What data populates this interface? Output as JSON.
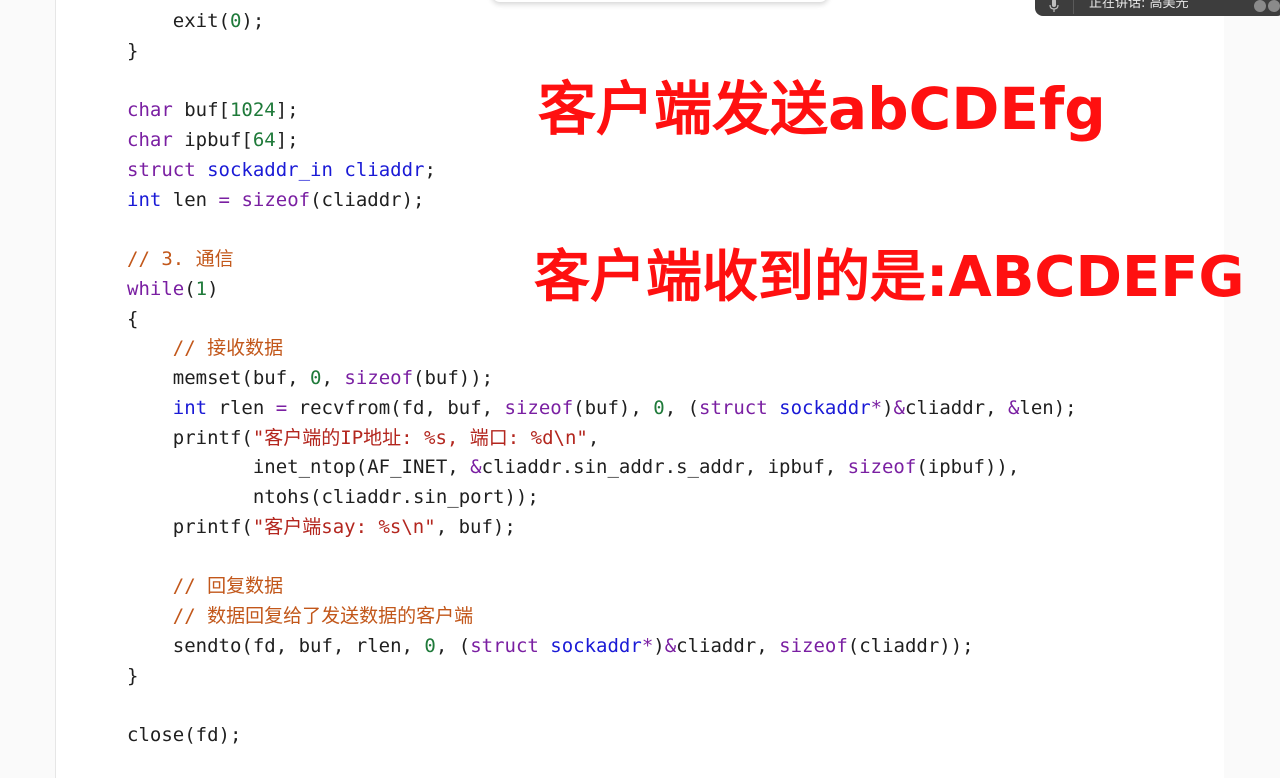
{
  "code": {
    "lines": [
      [
        {
          "t": "    exit(",
          "k": "plain"
        },
        {
          "t": "0",
          "k": "number"
        },
        {
          "t": ");",
          "k": "plain"
        }
      ],
      [
        {
          "t": "}",
          "k": "plain"
        }
      ],
      [],
      [
        {
          "t": "char",
          "k": "keyword"
        },
        {
          "t": " buf[",
          "k": "plain"
        },
        {
          "t": "1024",
          "k": "number"
        },
        {
          "t": "];",
          "k": "plain"
        }
      ],
      [
        {
          "t": "char",
          "k": "keyword"
        },
        {
          "t": " ipbuf[",
          "k": "plain"
        },
        {
          "t": "64",
          "k": "number"
        },
        {
          "t": "];",
          "k": "plain"
        }
      ],
      [
        {
          "t": "struct",
          "k": "keyword"
        },
        {
          "t": " ",
          "k": "plain"
        },
        {
          "t": "sockaddr_in",
          "k": "type"
        },
        {
          "t": " ",
          "k": "plain"
        },
        {
          "t": "cliaddr",
          "k": "type"
        },
        {
          "t": ";",
          "k": "plain"
        }
      ],
      [
        {
          "t": "int",
          "k": "type"
        },
        {
          "t": " len ",
          "k": "plain"
        },
        {
          "t": "=",
          "k": "keyword"
        },
        {
          "t": " ",
          "k": "plain"
        },
        {
          "t": "sizeof",
          "k": "keyword"
        },
        {
          "t": "(cliaddr);",
          "k": "plain"
        }
      ],
      [],
      [
        {
          "t": "// 3. 通信",
          "k": "comment"
        }
      ],
      [
        {
          "t": "while",
          "k": "keyword"
        },
        {
          "t": "(",
          "k": "plain"
        },
        {
          "t": "1",
          "k": "number"
        },
        {
          "t": ")",
          "k": "plain"
        }
      ],
      [
        {
          "t": "{",
          "k": "plain"
        }
      ],
      [
        {
          "t": "    ",
          "k": "plain"
        },
        {
          "t": "// 接收数据",
          "k": "comment"
        }
      ],
      [
        {
          "t": "    memset(buf, ",
          "k": "plain"
        },
        {
          "t": "0",
          "k": "number"
        },
        {
          "t": ", ",
          "k": "plain"
        },
        {
          "t": "sizeof",
          "k": "keyword"
        },
        {
          "t": "(buf));",
          "k": "plain"
        }
      ],
      [
        {
          "t": "    ",
          "k": "plain"
        },
        {
          "t": "int",
          "k": "type"
        },
        {
          "t": " rlen ",
          "k": "plain"
        },
        {
          "t": "=",
          "k": "keyword"
        },
        {
          "t": " recvfrom(fd, buf, ",
          "k": "plain"
        },
        {
          "t": "sizeof",
          "k": "keyword"
        },
        {
          "t": "(buf), ",
          "k": "plain"
        },
        {
          "t": "0",
          "k": "number"
        },
        {
          "t": ", (",
          "k": "plain"
        },
        {
          "t": "struct",
          "k": "keyword"
        },
        {
          "t": " ",
          "k": "plain"
        },
        {
          "t": "sockaddr",
          "k": "type"
        },
        {
          "t": "*",
          "k": "keyword"
        },
        {
          "t": ")",
          "k": "plain"
        },
        {
          "t": "&",
          "k": "keyword"
        },
        {
          "t": "cliaddr, ",
          "k": "plain"
        },
        {
          "t": "&",
          "k": "keyword"
        },
        {
          "t": "len);",
          "k": "plain"
        }
      ],
      [
        {
          "t": "    printf(",
          "k": "plain"
        },
        {
          "t": "\"客户端的IP地址: %s, 端口: %d\\n\"",
          "k": "string"
        },
        {
          "t": ",",
          "k": "plain"
        }
      ],
      [
        {
          "t": "           inet_ntop(AF_INET, ",
          "k": "plain"
        },
        {
          "t": "&",
          "k": "keyword"
        },
        {
          "t": "cliaddr.sin_addr.s_addr, ipbuf, ",
          "k": "plain"
        },
        {
          "t": "sizeof",
          "k": "keyword"
        },
        {
          "t": "(ipbuf)),",
          "k": "plain"
        }
      ],
      [
        {
          "t": "           ntohs(cliaddr.sin_port));",
          "k": "plain"
        }
      ],
      [
        {
          "t": "    printf(",
          "k": "plain"
        },
        {
          "t": "\"客户端say: %s\\n\"",
          "k": "string"
        },
        {
          "t": ", buf);",
          "k": "plain"
        }
      ],
      [],
      [
        {
          "t": "    ",
          "k": "plain"
        },
        {
          "t": "// 回复数据",
          "k": "comment"
        }
      ],
      [
        {
          "t": "    ",
          "k": "plain"
        },
        {
          "t": "// 数据回复给了发送数据的客户端",
          "k": "comment"
        }
      ],
      [
        {
          "t": "    sendto(fd, buf, rlen, ",
          "k": "plain"
        },
        {
          "t": "0",
          "k": "number"
        },
        {
          "t": ", (",
          "k": "plain"
        },
        {
          "t": "struct",
          "k": "keyword"
        },
        {
          "t": " ",
          "k": "plain"
        },
        {
          "t": "sockaddr",
          "k": "type"
        },
        {
          "t": "*",
          "k": "keyword"
        },
        {
          "t": ")",
          "k": "plain"
        },
        {
          "t": "&",
          "k": "keyword"
        },
        {
          "t": "cliaddr, ",
          "k": "plain"
        },
        {
          "t": "sizeof",
          "k": "keyword"
        },
        {
          "t": "(cliaddr));",
          "k": "plain"
        }
      ],
      [
        {
          "t": "}",
          "k": "plain"
        }
      ],
      [],
      [
        {
          "t": "close(fd);",
          "k": "plain"
        }
      ]
    ]
  },
  "annotations": {
    "client_sends": "客户端发送abCDEfg",
    "client_receives": "客户端收到的是:ABCDEFG"
  },
  "voice_bar": {
    "status_text": "正在讲话: 高美光",
    "icon": "microphone-icon"
  },
  "colors": {
    "annotation": "#ff1010",
    "keyword": "#7a1fa2",
    "type": "#1a1ad6",
    "number": "#1f7a3a",
    "string": "#b3261e",
    "comment": "#c2571a"
  }
}
